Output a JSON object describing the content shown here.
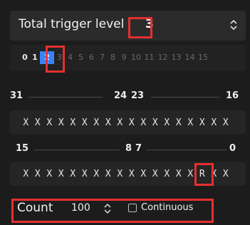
{
  "trigger_level": {
    "label": "Total trigger level",
    "value": "3"
  },
  "levels": [
    "0",
    "1",
    "2",
    "3",
    "4",
    "5",
    "6",
    "7",
    "8",
    "9",
    "10",
    "11",
    "12",
    "13",
    "14",
    "15"
  ],
  "selected_level": "2",
  "upper_word": {
    "labels": [
      "31",
      "24",
      "23",
      "16"
    ],
    "bits": [
      "X",
      "X",
      "X",
      "X",
      "X",
      "X",
      "X",
      "X",
      "X",
      "X",
      "X",
      "X",
      "X",
      "X",
      "X",
      "X",
      "X",
      "X"
    ]
  },
  "lower_word": {
    "labels": [
      "15",
      "8",
      "7",
      "0"
    ],
    "bits": [
      "X",
      "X",
      "X",
      "X",
      "X",
      "X",
      "X",
      "X",
      "X",
      "X",
      "X",
      "X",
      "X",
      "X",
      "X",
      "R",
      "X",
      "X"
    ],
    "highlighted_bit": "R"
  },
  "count": {
    "label": "Count",
    "value": "100"
  },
  "continuous": {
    "label": "Continuous",
    "checked": false
  },
  "colors": {
    "highlight": "#e5302f",
    "selected_chip": "#3b82f6"
  }
}
